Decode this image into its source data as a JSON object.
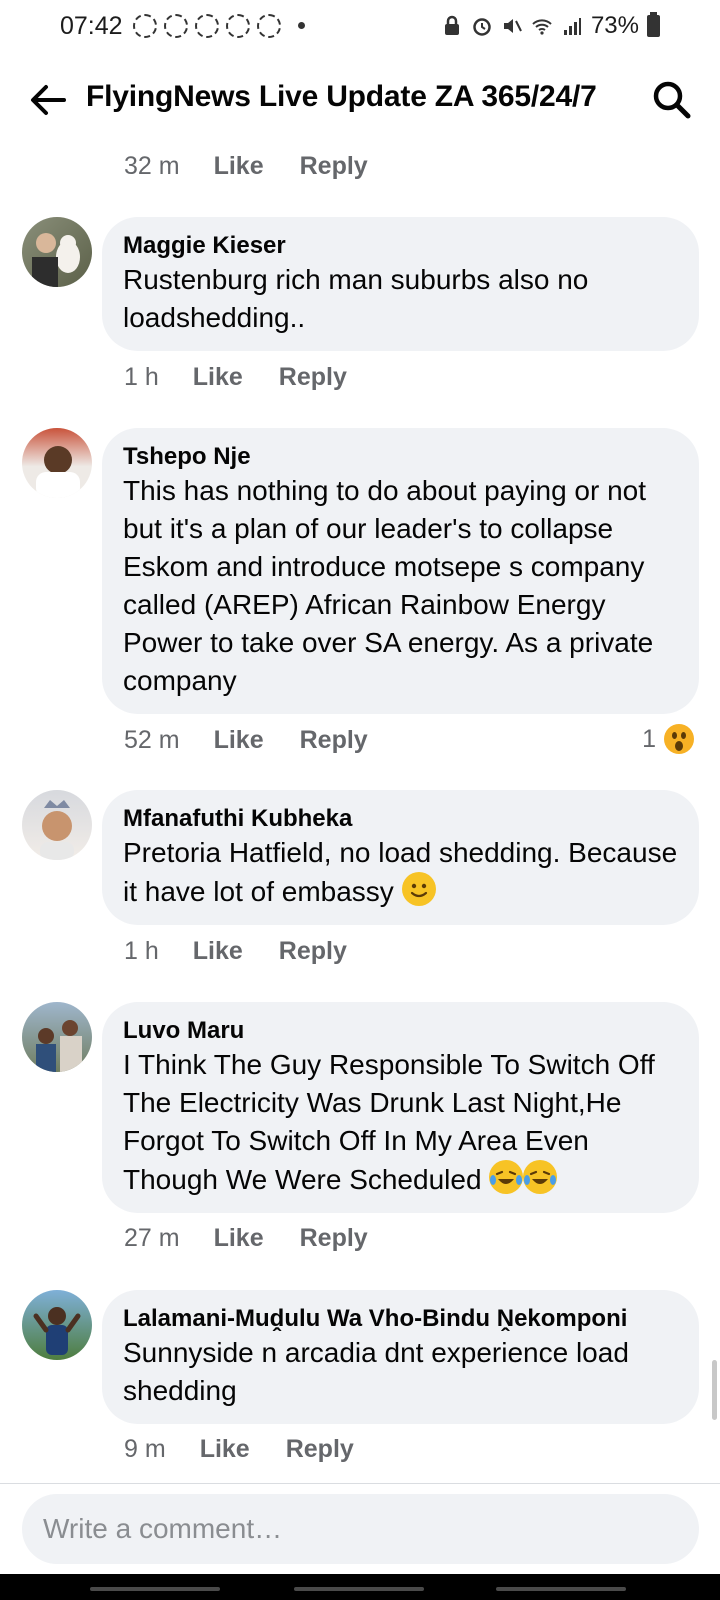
{
  "status": {
    "time": "07:42",
    "battery": "73%"
  },
  "header": {
    "title": "FlyingNews Live Update ZA 365/24/7"
  },
  "top_meta": {
    "time": "32 m",
    "like": "Like",
    "reply": "Reply"
  },
  "comments": [
    {
      "author": "Maggie Kieser",
      "text": "Rustenburg rich man suburbs also no loadshedding..",
      "time": "1 h",
      "like": "Like",
      "reply": "Reply"
    },
    {
      "author": "Tshepo Nje",
      "text": "This has nothing to do about paying or not but it's a plan of our leader's to collapse Eskom  and  introduce motsepe s company called (AREP)  African Rainbow Energy Power to take over SA energy.  As a private company",
      "time": "52 m",
      "like": "Like",
      "reply": "Reply",
      "reaction_count": "1"
    },
    {
      "author": "Mfanafuthi Kubheka",
      "text": "Pretoria Hatfield,  no load shedding. Because it have lot of embassy",
      "time": "1 h",
      "like": "Like",
      "reply": "Reply"
    },
    {
      "author": "Luvo Maru",
      "text": "I Think The Guy Responsible To Switch Off The Electricity Was Drunk Last Night,He Forgot To Switch Off In My Area Even Though We Were Scheduled",
      "time": "27 m",
      "like": "Like",
      "reply": "Reply"
    },
    {
      "author": "Lalamani-Muḓulu Wa Vho-Bindu Ṋekomponi",
      "text": "Sunnyside n arcadia dnt experience load shedding",
      "time": "9 m",
      "like": "Like",
      "reply": "Reply"
    }
  ],
  "composer": {
    "placeholder": "Write a comment…"
  },
  "icons": {
    "back": "arrow-left-icon",
    "search": "search-icon",
    "reaction": "wow-emoji-icon"
  },
  "colors": {
    "bubble": "#f0f2f5",
    "meta_text": "#65676b",
    "reaction": "#f7b125"
  }
}
